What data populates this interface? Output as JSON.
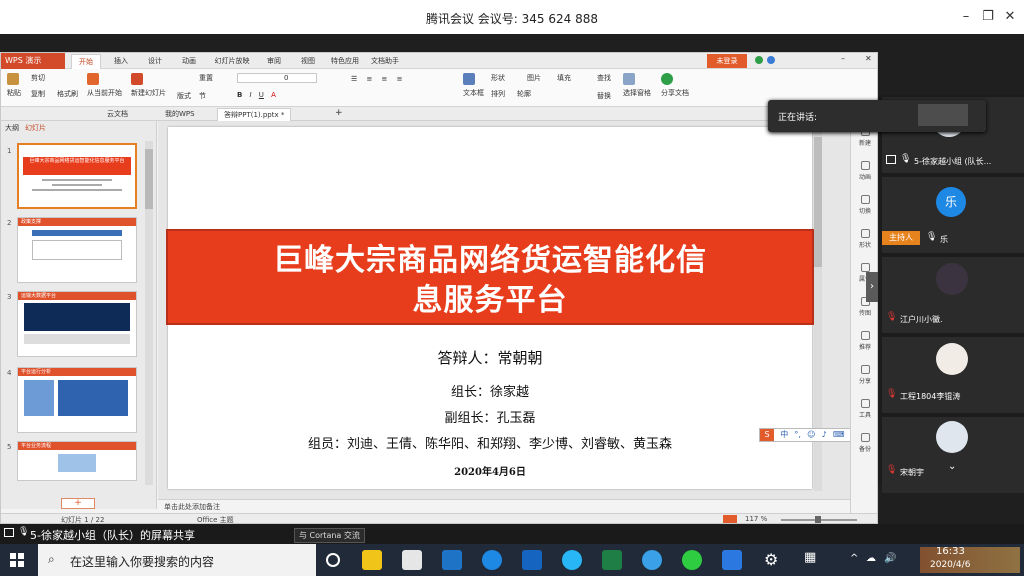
{
  "meeting": {
    "title": "腾讯会议 会议号: 345 624 888",
    "min_icon": "minimize-icon",
    "restore_icon": "restore-icon",
    "close_icon": "close-icon"
  },
  "wps": {
    "app_label": "WPS 演示",
    "menu_tabs": [
      "开始",
      "插入",
      "设计",
      "动画",
      "幻灯片放映",
      "审阅",
      "视图",
      "特色应用",
      "文档助手"
    ],
    "active_tab": "开始",
    "login_label": "未登录",
    "ribbon": {
      "paste": "粘贴",
      "cut": "剪切",
      "copy": "复制",
      "format_painter": "格式刷",
      "from_current": "从当前开始",
      "new_slide": "新建幻灯片",
      "layout": "版式",
      "section": "节",
      "reset": "重置",
      "font_size": "0",
      "textbox": "文本框",
      "shape": "形状",
      "arrange": "排列",
      "outline": "轮廓",
      "picture": "图片",
      "fill": "填充",
      "find": "查找",
      "replace": "替换",
      "select_pane": "选择窗格",
      "share_doc": "分享文档"
    },
    "doc_tabs": [
      "云文档",
      "我的WPS",
      "答辩PPT(1).pptx *"
    ],
    "panel_tabs": [
      "大纲",
      "幻灯片"
    ],
    "slide_numbers": [
      "1",
      "2",
      "3",
      "4",
      "5"
    ],
    "add_slide": "+",
    "thumb_texts": {
      "t1_title": "巨峰大宗商品网络货运智能化信息服务平台",
      "t2_head": "政策支撑",
      "t3_head": "运输大数据平台",
      "t4_head": "平台运行分析",
      "t5_head": "平台业务流程"
    },
    "slide": {
      "title_line1": "巨峰大宗商品网络货运智能化信",
      "title_line2": "息服务平台",
      "defender": "答辩人：常朝朝",
      "leader": "组长：徐家越",
      "vice_leader": "副组长：孔玉磊",
      "members": "组员：刘迪、王倩、陈华阳、和郑翔、李少博、刘睿敏、黄玉森",
      "date": "2020年4月6日"
    },
    "notes_placeholder": "单击此处添加备注",
    "right_tools": [
      "新建",
      "动画",
      "切换",
      "形状",
      "属性",
      "传图",
      "推荐",
      "分享",
      "工具",
      "备份"
    ],
    "status": {
      "slide_info": "幻灯片 1 / 22",
      "theme": "Office 主题",
      "zoom": "117 %"
    }
  },
  "participants": {
    "speaking_label": "正在讲话:",
    "tiles": [
      {
        "name": "5-徐家越小组 (队长...",
        "avatar_char": ""
      },
      {
        "name": "乐",
        "avatar_char": "乐",
        "role": "主持人"
      },
      {
        "name": "江户川小黴.",
        "avatar_char": ""
      },
      {
        "name": "工程1804李锟涛",
        "avatar_char": ""
      },
      {
        "name": "宋朝宇",
        "avatar_char": ""
      }
    ],
    "chevron_icon": "chevron-down-icon"
  },
  "share_strip": {
    "label": "5-徐家越小组（队长）的屏幕共享",
    "cortana_tip": "与 Cortana 交流"
  },
  "taskbar": {
    "search_placeholder": "在这里输入你要搜索的内容",
    "time": "16:33",
    "date": "2020/4/6"
  },
  "colors": {
    "accent": "#e83d1d",
    "wps_brand": "#d24a2a",
    "taskbar": "#202a38",
    "host_badge": "#e6831d"
  }
}
